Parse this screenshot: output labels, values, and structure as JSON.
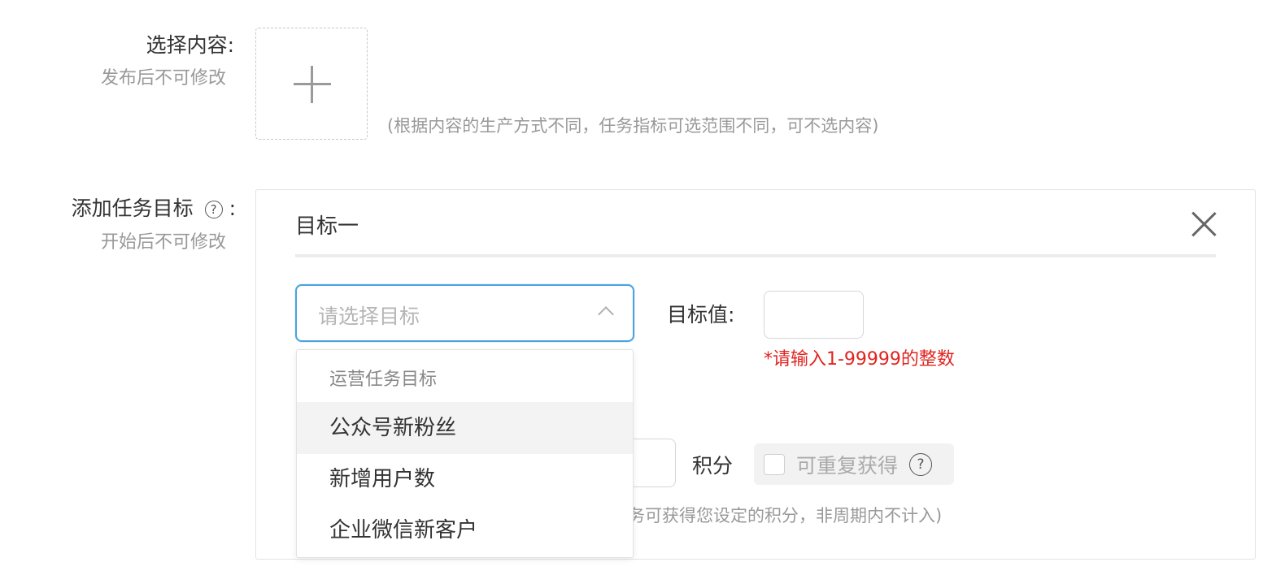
{
  "content_row": {
    "label": "选择内容:",
    "sublabel": "发布后不可修改",
    "hint": "(根据内容的生产方式不同，任务指标可选范围不同，可不选内容)"
  },
  "goal_row": {
    "label": "添加任务目标",
    "help_glyph": "?",
    "colon": ":",
    "sublabel": "开始后不可修改"
  },
  "goal_panel": {
    "title": "目标一",
    "select_placeholder": "请选择目标",
    "target_label": "目标值:",
    "target_value": "",
    "error": "*请输入1-99999的整数",
    "points_label": "积分",
    "repeat_label": "可重复获得",
    "repeat_help_glyph": "?",
    "points_hint": "务可获得您设定的积分，非周期内不计入)"
  },
  "dropdown": {
    "group_label": "运营任务目标",
    "options": [
      "公众号新粉丝",
      "新增用户数",
      "企业微信新客户"
    ]
  },
  "colors": {
    "accent_border": "#4aa3df",
    "error": "#e0241f"
  }
}
